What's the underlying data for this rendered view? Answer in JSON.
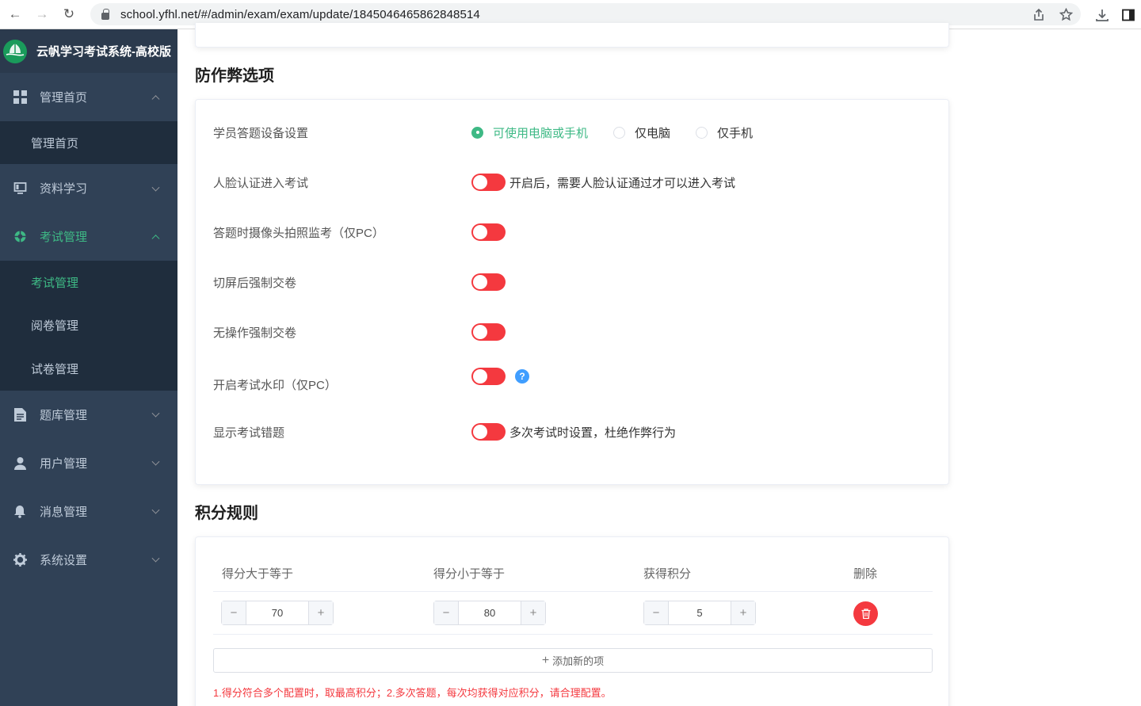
{
  "browser": {
    "back_icon": "←",
    "forward_icon": "→",
    "reload_icon": "↻",
    "url": "school.yfhl.net/#/admin/exam/exam/update/1845046465862848514"
  },
  "sidebar": {
    "brand": "云帆学习考试系统-高校版",
    "menus": [
      {
        "label": "管理首页",
        "icon": "grid-icon"
      },
      {
        "label": "资料学习",
        "icon": "monitor-icon"
      },
      {
        "label": "考试管理",
        "icon": "exam-icon"
      },
      {
        "label": "题库管理",
        "icon": "document-icon"
      },
      {
        "label": "用户管理",
        "icon": "user-icon"
      },
      {
        "label": "消息管理",
        "icon": "bell-icon"
      },
      {
        "label": "系统设置",
        "icon": "gear-icon"
      }
    ],
    "sub_home": [
      "管理首页"
    ],
    "sub_exam": [
      "考试管理",
      "阅卷管理",
      "试卷管理"
    ]
  },
  "anti_cheat": {
    "title": "防作弊选项",
    "device": {
      "label": "学员答题设备设置",
      "options": [
        "可使用电脑或手机",
        "仅电脑",
        "仅手机"
      ],
      "selected": "可使用电脑或手机"
    },
    "rows": [
      {
        "label": "人脸认证进入考试",
        "note": "开启后，需要人脸认证通过才可以进入考试"
      },
      {
        "label": "答题时摄像头拍照监考（仅PC）",
        "note": ""
      },
      {
        "label": "切屏后强制交卷",
        "note": ""
      },
      {
        "label": "无操作强制交卷",
        "note": ""
      },
      {
        "label": "开启考试水印（仅PC）",
        "note": ""
      },
      {
        "label": "显示考试错题",
        "note": "多次考试时设置，杜绝作弊行为"
      }
    ],
    "help_icon": "?"
  },
  "points": {
    "title": "积分规则",
    "headers": [
      "得分大于等于",
      "得分小于等于",
      "获得积分",
      "删除"
    ],
    "rows": [
      {
        "min": "70",
        "max": "80",
        "points": "5"
      }
    ],
    "stepper_minus": "−",
    "stepper_plus": "+",
    "add_label": "添加新的项",
    "add_icon": "+",
    "note": "1.得分符合多个配置时，取最高积分；2.多次答题，每次均获得对应积分，请合理配置。"
  },
  "colors": {
    "accent": "#3eb985",
    "danger": "#f4393f",
    "sidebar_bg": "#304156",
    "submenu_bg": "#1f2d3d",
    "help": "#409eff"
  }
}
